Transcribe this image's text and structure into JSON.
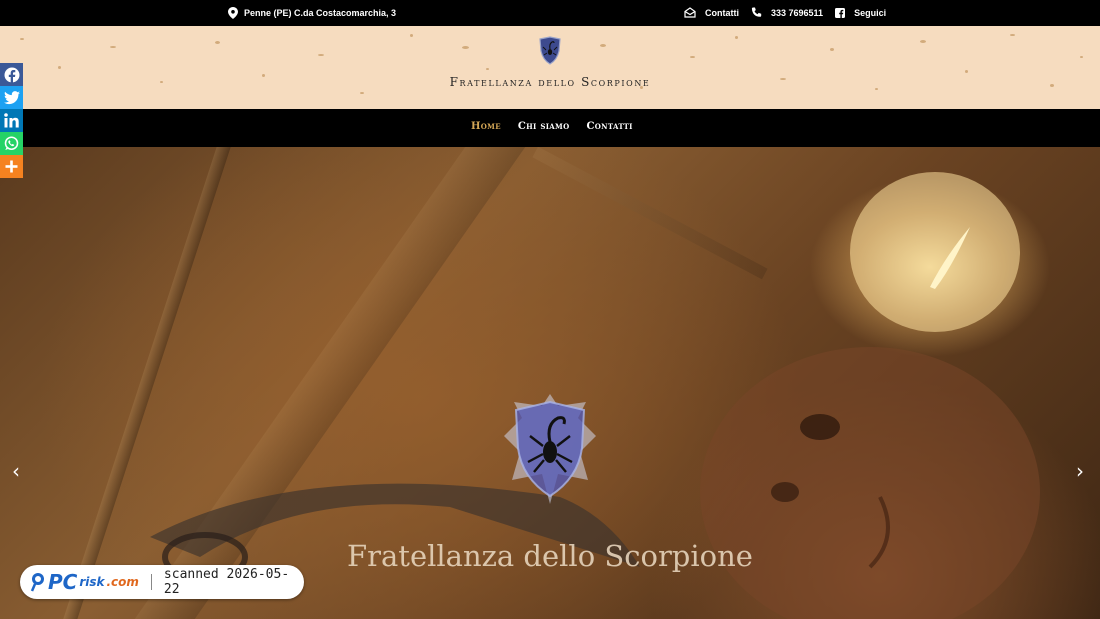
{
  "topbar": {
    "address": "Penne (PE) C.da Costacomarchia, 3",
    "contact_label": "Contatti",
    "phone": "333 7696511",
    "follow_label": "Seguici"
  },
  "header": {
    "site_title": "Fratellanza dello Scorpione"
  },
  "nav": {
    "items": [
      "Home",
      "Chi siamo",
      "Contatti"
    ],
    "active": "Home"
  },
  "hero": {
    "caption": "Fratellanza dello Scorpione"
  },
  "social": {
    "buttons": [
      "facebook",
      "twitter",
      "linkedin",
      "whatsapp",
      "more"
    ]
  },
  "watermark": {
    "brand_pc": "PC",
    "brand_risk": "risk",
    "brand_com": ".com",
    "stamp": "scanned 2026-05-22"
  },
  "colors": {
    "header_bg": "#f6dcbf",
    "nav_active": "#d6a857",
    "facebook": "#3b5998",
    "twitter": "#1da1f2",
    "linkedin": "#0077b5",
    "whatsapp": "#25d366",
    "more": "#f58220"
  }
}
